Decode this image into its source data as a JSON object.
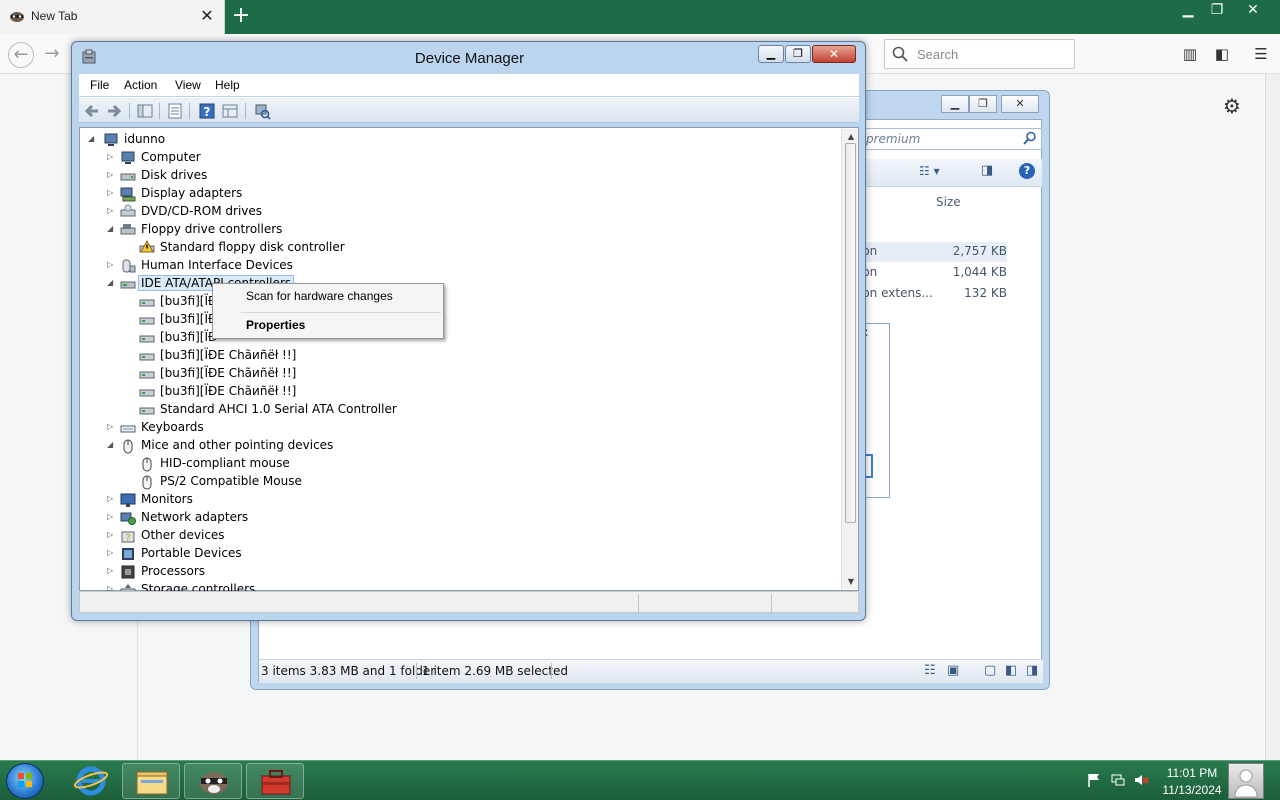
{
  "browser": {
    "tab_title": "New Tab",
    "tab_close": "✕",
    "new_tab": "+",
    "window_minimize": "▁",
    "window_maximize": "❐",
    "window_close": "✕",
    "search_placeholder": "Search"
  },
  "explorer": {
    "search_placeholder": "premium",
    "size_header": "Size",
    "rows": [
      {
        "name": "ion",
        "size": "2,757 KB"
      },
      {
        "name": "ion",
        "size": "1,044 KB"
      },
      {
        "name": "ion extens...",
        "size": "132 KB"
      }
    ],
    "status_left": "3 items 3.83 MB and 1 folder",
    "status_right": "1 item 2.69 MB selected"
  },
  "device_manager": {
    "title": "Device Manager",
    "menu": [
      "File",
      "Action",
      "View",
      "Help"
    ],
    "root": "idunno",
    "tree": [
      {
        "label": "Computer",
        "level": 1,
        "arrow": "collapsed",
        "icon": "computer-icon"
      },
      {
        "label": "Disk drives",
        "level": 1,
        "arrow": "collapsed",
        "icon": "disk-drive-icon"
      },
      {
        "label": "Display adapters",
        "level": 1,
        "arrow": "collapsed",
        "icon": "display-adapter-icon"
      },
      {
        "label": "DVD/CD-ROM drives",
        "level": 1,
        "arrow": "collapsed",
        "icon": "dvd-drive-icon"
      },
      {
        "label": "Floppy drive controllers",
        "level": 1,
        "arrow": "expanded",
        "icon": "floppy-controller-icon"
      },
      {
        "label": "Standard floppy disk controller",
        "level": 2,
        "arrow": "none",
        "icon": "warning-device-icon"
      },
      {
        "label": "Human Interface Devices",
        "level": 1,
        "arrow": "collapsed",
        "icon": "hid-icon"
      },
      {
        "label": "IDE ATA/ATAPI controllers",
        "level": 1,
        "arrow": "expanded",
        "icon": "ide-controller-icon",
        "selected": true
      },
      {
        "label": "[bu3fi][ÏÐ",
        "level": 2,
        "arrow": "none",
        "icon": "ide-channel-icon"
      },
      {
        "label": "[bu3fi][ÏÐ",
        "level": 2,
        "arrow": "none",
        "icon": "ide-channel-icon"
      },
      {
        "label": "[bu3fi][ÏÐ",
        "level": 2,
        "arrow": "none",
        "icon": "ide-channel-icon"
      },
      {
        "label": "[bu3fi][ÏÐE Chãиñëł !!]",
        "level": 2,
        "arrow": "none",
        "icon": "ide-channel-icon"
      },
      {
        "label": "[bu3fi][ÏÐE Chãиñëł !!]",
        "level": 2,
        "arrow": "none",
        "icon": "ide-channel-icon"
      },
      {
        "label": "[bu3fi][ÏÐE Chãиñëł !!]",
        "level": 2,
        "arrow": "none",
        "icon": "ide-channel-icon"
      },
      {
        "label": "Standard AHCI 1.0 Serial ATA Controller",
        "level": 2,
        "arrow": "none",
        "icon": "ide-channel-icon"
      },
      {
        "label": "Keyboards",
        "level": 1,
        "arrow": "collapsed",
        "icon": "keyboard-icon"
      },
      {
        "label": "Mice and other pointing devices",
        "level": 1,
        "arrow": "expanded",
        "icon": "mouse-icon"
      },
      {
        "label": "HID-compliant mouse",
        "level": 2,
        "arrow": "none",
        "icon": "mouse-icon"
      },
      {
        "label": "PS/2 Compatible Mouse",
        "level": 2,
        "arrow": "none",
        "icon": "mouse-icon"
      },
      {
        "label": "Monitors",
        "level": 1,
        "arrow": "collapsed",
        "icon": "monitor-icon"
      },
      {
        "label": "Network adapters",
        "level": 1,
        "arrow": "collapsed",
        "icon": "network-adapter-icon"
      },
      {
        "label": "Other devices",
        "level": 1,
        "arrow": "collapsed",
        "icon": "other-devices-icon"
      },
      {
        "label": "Portable Devices",
        "level": 1,
        "arrow": "collapsed",
        "icon": "portable-device-icon"
      },
      {
        "label": "Processors",
        "level": 1,
        "arrow": "collapsed",
        "icon": "processor-icon"
      },
      {
        "label": "Storage controllers",
        "level": 1,
        "arrow": "collapsed",
        "icon": "storage-controller-icon"
      }
    ],
    "context_menu": {
      "scan": "Scan for hardware changes",
      "properties": "Properties"
    }
  },
  "taskbar": {
    "time": "11:01 PM",
    "date": "11/13/2024"
  },
  "colors": {
    "taskbar": "#1e6b48",
    "dm_frame": "#bcd5ee",
    "selection": "#dbe9f7"
  }
}
